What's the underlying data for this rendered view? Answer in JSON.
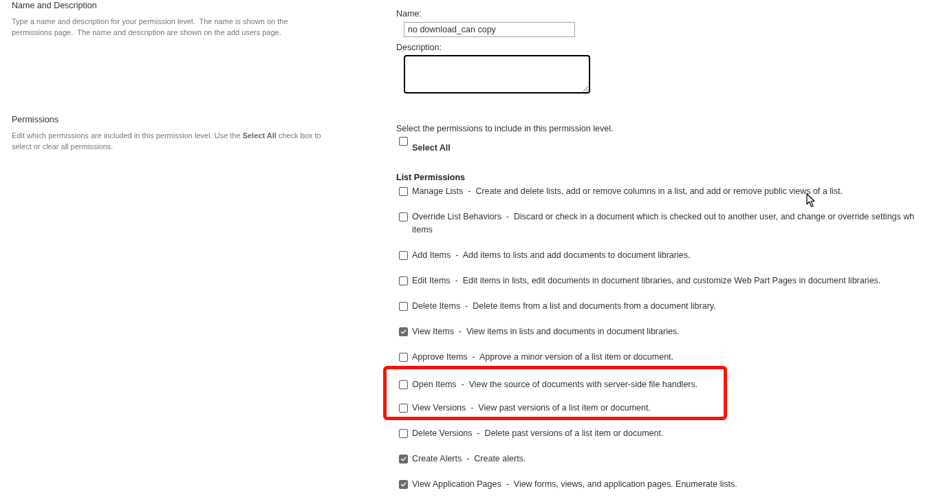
{
  "name_and_description": {
    "title": "Name and Description",
    "description": "Type a name and description for your permission level.  The name is shown on the permissions page.  The name and description are shown on the add users page.",
    "name_label": "Name:",
    "name_value": "no download_can copy",
    "description_label": "Description:"
  },
  "permissions": {
    "title": "Permissions",
    "description": "Edit which permissions are included in this permission level. Use the **Select All** check box to select or clear all permissions.",
    "intro": "Select the permissions to include in this permission level.",
    "select_all": {
      "label": "Select All",
      "checked": false
    },
    "groups": [
      {
        "title": "List Permissions",
        "items": [
          {
            "label": "Manage Lists  -  Create and delete lists, add or remove columns in a list, and add or remove public views of a list.",
            "checked": false,
            "highlighted": false
          },
          {
            "label": "Override List Behaviors  -  Discard or check in a document which is checked out to another user, and change or override settings wh\nitems",
            "checked": false,
            "highlighted": false
          },
          {
            "label": "Add Items  -  Add items to lists and add documents to document libraries.",
            "checked": false,
            "highlighted": false
          },
          {
            "label": "Edit Items  -  Edit items in lists, edit documents in document libraries, and customize Web Part Pages in document libraries.",
            "checked": false,
            "highlighted": false
          },
          {
            "label": "Delete Items  -  Delete items from a list and documents from a document library.",
            "checked": false,
            "highlighted": false
          },
          {
            "label": "View Items  -  View items in lists and documents in document libraries.",
            "checked": true,
            "highlighted": false
          },
          {
            "label": "Approve Items  -  Approve a minor version of a list item or document.",
            "checked": false,
            "highlighted": false
          },
          {
            "label": "Open Items  -  View the source of documents with server-side file handlers.",
            "checked": false,
            "highlighted": true
          },
          {
            "label": "View Versions  -  View past versions of a list item or document.",
            "checked": false,
            "highlighted": true
          },
          {
            "label": "Delete Versions  -  Delete past versions of a list item or document.",
            "checked": false,
            "highlighted": false
          },
          {
            "label": "Create Alerts  -  Create alerts.",
            "checked": true,
            "highlighted": false
          },
          {
            "label": "View Application Pages  -  View forms, views, and application pages. Enumerate lists.",
            "checked": true,
            "highlighted": false
          }
        ]
      }
    ]
  }
}
